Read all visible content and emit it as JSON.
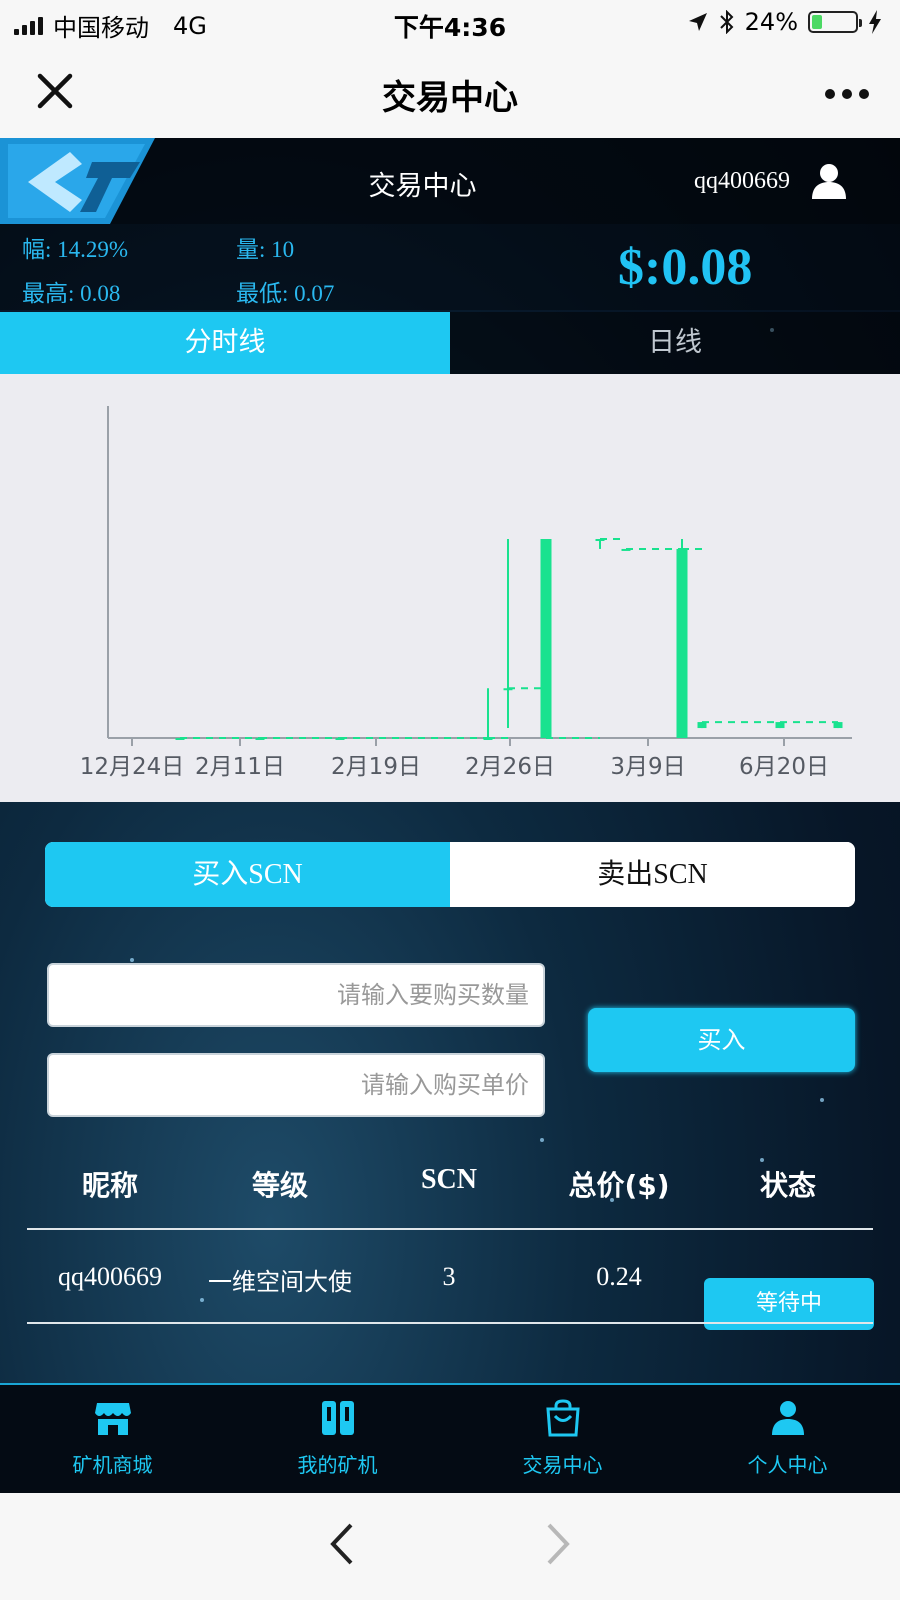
{
  "status_bar": {
    "carrier": "中国移动",
    "network": "4G",
    "time": "下午4:36",
    "battery": "24%",
    "battery_level": 0.24
  },
  "titlebar": {
    "close_icon": "close-icon",
    "title": "交易中心",
    "more_icon": "more-icon"
  },
  "app_header": {
    "title": "交易中心",
    "username": "qq400669",
    "user_icon": "user-icon"
  },
  "stats": {
    "change": "幅: 14.29%",
    "volume": "量: 10",
    "high": "最高: 0.08",
    "low": "最低: 0.07",
    "price": "$:0.08"
  },
  "chart_tabs": [
    {
      "label": "分时线",
      "active": true
    },
    {
      "label": "日线",
      "active": false
    }
  ],
  "chart_data": {
    "type": "candlestick",
    "x_ticks": [
      "12月24日",
      "2月11日",
      "2月19日",
      "2月26日",
      "3月9日",
      "6月20日"
    ],
    "ylim": [
      0.07,
      0.08
    ],
    "candles": [
      {
        "open": 0.07,
        "close": 0.07,
        "high": 0.07,
        "low": 0.07
      },
      {
        "open": 0.07,
        "close": 0.07,
        "high": 0.07,
        "low": 0.07
      },
      {
        "open": 0.07,
        "close": 0.07,
        "high": 0.07,
        "low": 0.07
      },
      {
        "open": 0.07,
        "close": 0.07,
        "high": 0.0725,
        "low": 0.07
      },
      {
        "open": 0.0725,
        "close": 0.0725,
        "high": 0.08,
        "low": 0.0705
      },
      {
        "open": 0.08,
        "close": 0.07,
        "high": 0.08,
        "low": 0.07
      },
      {
        "open": 0.08,
        "close": 0.08,
        "high": 0.08,
        "low": 0.0795
      },
      {
        "open": 0.0795,
        "close": 0.0795,
        "high": 0.0795,
        "low": 0.0795
      },
      {
        "open": 0.07,
        "close": 0.0795,
        "high": 0.08,
        "low": 0.07
      },
      {
        "open": 0.0705,
        "close": 0.0708,
        "high": 0.0708,
        "low": 0.0705
      },
      {
        "open": 0.0705,
        "close": 0.0708,
        "high": 0.0708,
        "low": 0.0705
      },
      {
        "open": 0.0705,
        "close": 0.0708,
        "high": 0.0708,
        "low": 0.0705
      }
    ],
    "colors": {
      "candle": "#19e28f",
      "axis": "#9aa0a8",
      "tick_text": "#555a63"
    }
  },
  "trade_tabs": [
    {
      "label": "买入SCN",
      "active": true
    },
    {
      "label": "卖出SCN",
      "active": false
    }
  ],
  "form": {
    "quantity_placeholder": "请输入要购买数量",
    "price_placeholder": "请输入购买单价",
    "buy_button": "买入"
  },
  "table": {
    "headers": [
      "昵称",
      "等级",
      "SCN",
      "总价($)",
      "状态"
    ],
    "rows": [
      {
        "nickname": "qq400669",
        "level": "一维空间大使",
        "scn": "3",
        "total": "0.24",
        "status": "等待中"
      }
    ]
  },
  "bottom_nav": [
    {
      "label": "矿机商城",
      "icon": "shop-icon"
    },
    {
      "label": "我的矿机",
      "icon": "machine-icon"
    },
    {
      "label": "交易中心",
      "icon": "bag-icon"
    },
    {
      "label": "个人中心",
      "icon": "person-icon"
    }
  ],
  "browser": {
    "back_icon": "back-icon",
    "forward_icon": "forward-icon"
  },
  "colors": {
    "accent": "#1ec8f2",
    "price": "#21c3f4",
    "candle": "#19e28f"
  }
}
